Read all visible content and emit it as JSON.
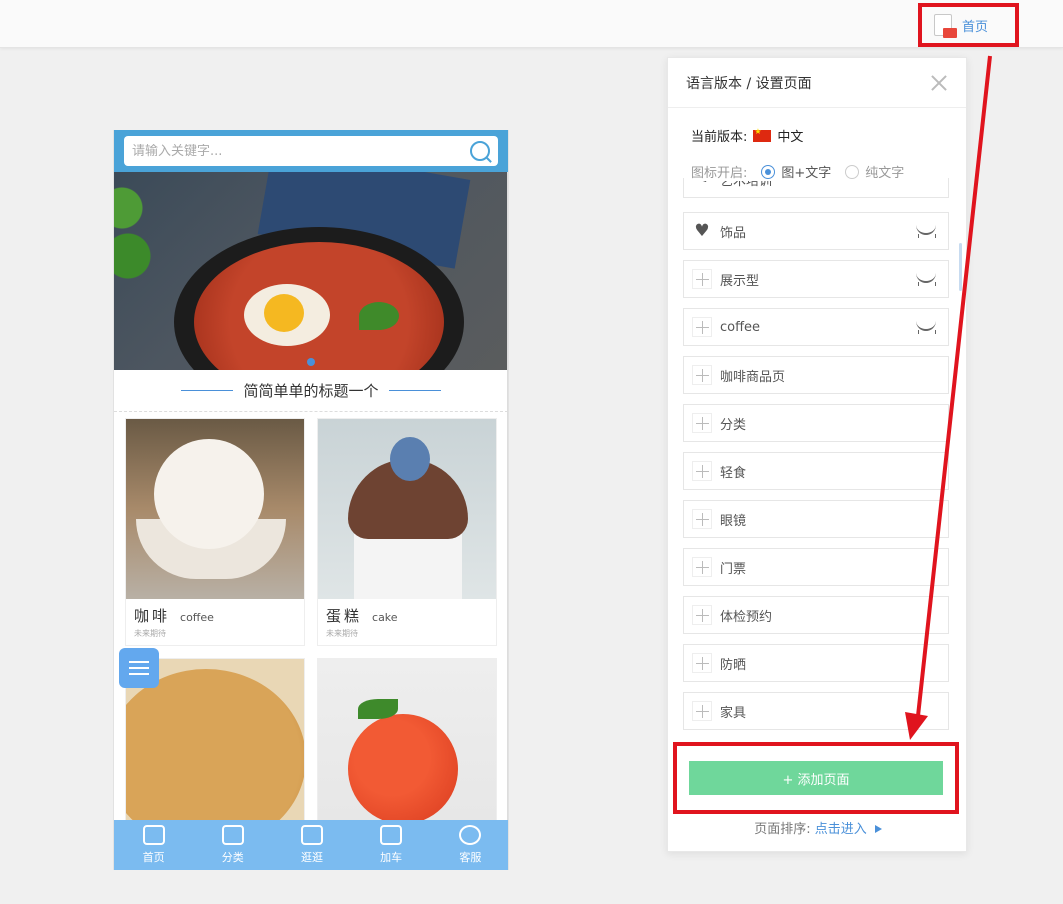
{
  "topbar": {
    "home_label": "首页"
  },
  "phone": {
    "search_placeholder": "请输入关键字...",
    "section_title": "简简单单的标题一个",
    "products": [
      {
        "name": "咖啡",
        "en": "coffee",
        "sub": "未来期待"
      },
      {
        "name": "蛋糕",
        "en": "cake",
        "sub": "未来期待"
      }
    ],
    "tabs": [
      "首页",
      "分类",
      "逛逛",
      "加车",
      "客服"
    ]
  },
  "panel": {
    "title": "语言版本 / 设置页面",
    "version_label": "当前版本:",
    "version_value": "中文",
    "icon_label": "图标开启:",
    "icon_options": [
      "图+文字",
      "纯文字"
    ],
    "selected_icon_option": "图+文字",
    "partial_item": "艺术培训",
    "pages": [
      "饰品",
      "展示型",
      "coffee",
      "咖啡商品页",
      "分类",
      "轻食",
      "眼镜",
      "门票",
      "体检预约",
      "防晒",
      "家具"
    ],
    "add_button": "+ 添加页面",
    "sort_label": "页面排序:",
    "sort_link": "点击进入"
  },
  "colors": {
    "highlight": "#e0141e",
    "accent": "#4a90d9",
    "add_button": "#6fd79b",
    "tabbar": "#7bbbf0"
  }
}
